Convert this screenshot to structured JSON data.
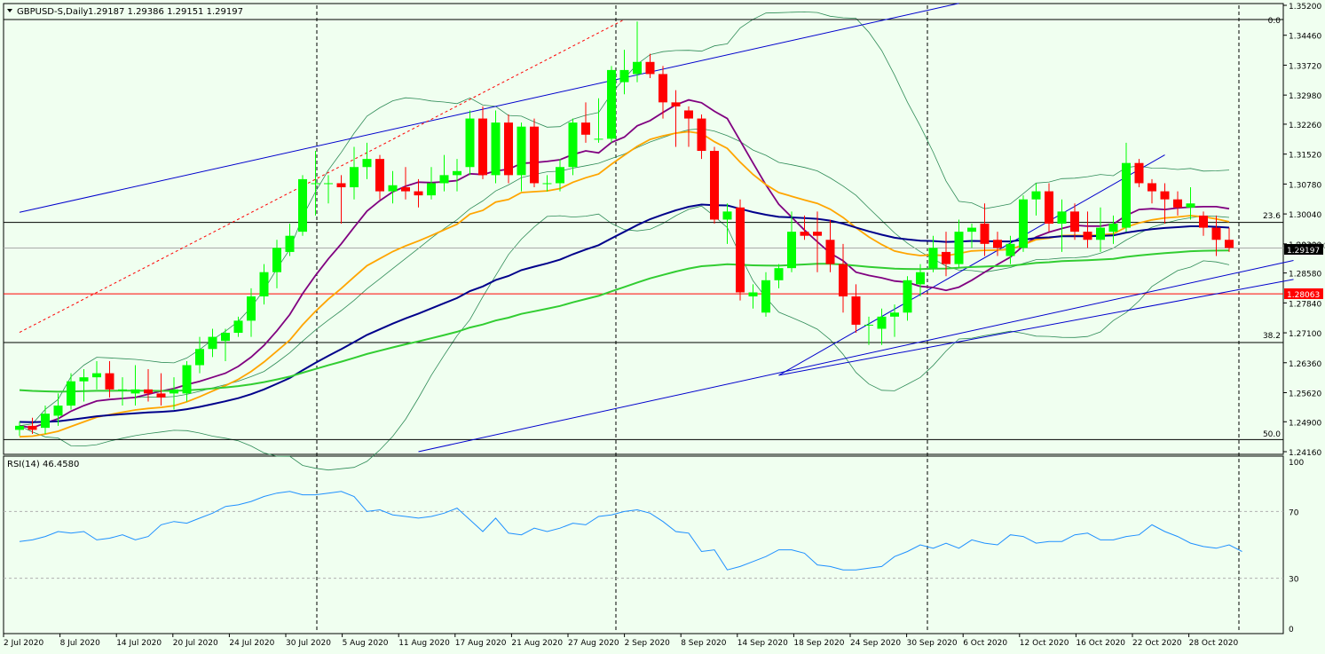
{
  "header": {
    "symbol_label": "GBPUSD-S,Daily",
    "ohlc_label": "1.29187 1.29386 1.29151 1.29197",
    "rsi_label": "RSI(14) 46.4580"
  },
  "colors": {
    "background": "#f0fff0",
    "bull_candle": "#00ff00",
    "bear_candle": "#ff0000",
    "ma_fast": "#800080",
    "ma_mid": "#ffa500",
    "ma_slow": "#00008b",
    "ma_long": "#32cd32",
    "bollinger": "#2e8b57",
    "trendline": "#0000cd",
    "rsi": "#1e90ff"
  },
  "chart_data": {
    "type": "candlestick",
    "x_labels": [
      "2 Jul 2020",
      "8 Jul 2020",
      "14 Jul 2020",
      "20 Jul 2020",
      "24 Jul 2020",
      "30 Jul 2020",
      "5 Aug 2020",
      "11 Aug 2020",
      "17 Aug 2020",
      "21 Aug 2020",
      "27 Aug 2020",
      "2 Sep 2020",
      "8 Sep 2020",
      "14 Sep 2020",
      "18 Sep 2020",
      "24 Sep 2020",
      "30 Sep 2020",
      "6 Oct 2020",
      "12 Oct 2020",
      "16 Oct 2020",
      "22 Oct 2020",
      "28 Oct 2020"
    ],
    "y_ticks": [
      "1.35200",
      "1.34460",
      "1.33720",
      "1.32980",
      "1.32260",
      "1.31520",
      "1.30780",
      "1.30040",
      "1.29300",
      "1.28580",
      "1.27840",
      "1.27100",
      "1.26360",
      "1.25620",
      "1.24900",
      "1.24160"
    ],
    "ylim": [
      1.2416,
      1.352
    ],
    "candles": [
      [
        1.247,
        1.249,
        1.2455,
        1.248
      ],
      [
        1.248,
        1.25,
        1.246,
        1.247
      ],
      [
        1.2475,
        1.253,
        1.246,
        1.251
      ],
      [
        1.2505,
        1.256,
        1.248,
        1.253
      ],
      [
        1.253,
        1.261,
        1.252,
        1.259
      ],
      [
        1.259,
        1.262,
        1.254,
        1.26
      ],
      [
        1.26,
        1.264,
        1.257,
        1.261
      ],
      [
        1.261,
        1.264,
        1.255,
        1.257
      ],
      [
        1.257,
        1.26,
        1.253,
        1.257
      ],
      [
        1.256,
        1.263,
        1.253,
        1.257
      ],
      [
        1.257,
        1.262,
        1.254,
        1.256
      ],
      [
        1.256,
        1.261,
        1.253,
        1.255
      ],
      [
        1.256,
        1.26,
        1.252,
        1.257
      ],
      [
        1.256,
        1.264,
        1.254,
        1.263
      ],
      [
        1.263,
        1.27,
        1.261,
        1.267
      ],
      [
        1.267,
        1.272,
        1.265,
        1.27
      ],
      [
        1.269,
        1.272,
        1.264,
        1.271
      ],
      [
        1.271,
        1.275,
        1.27,
        1.274
      ],
      [
        1.274,
        1.282,
        1.27,
        1.28
      ],
      [
        1.28,
        1.288,
        1.278,
        1.286
      ],
      [
        1.286,
        1.294,
        1.282,
        1.292
      ],
      [
        1.291,
        1.298,
        1.29,
        1.295
      ],
      [
        1.296,
        1.31,
        1.295,
        1.309
      ],
      [
        1.308,
        1.316,
        1.3,
        1.308
      ],
      [
        1.308,
        1.31,
        1.303,
        1.308
      ],
      [
        1.308,
        1.31,
        1.298,
        1.307
      ],
      [
        1.307,
        1.317,
        1.304,
        1.312
      ],
      [
        1.312,
        1.318,
        1.309,
        1.314
      ],
      [
        1.314,
        1.315,
        1.304,
        1.306
      ],
      [
        1.306,
        1.311,
        1.303,
        1.3075
      ],
      [
        1.307,
        1.312,
        1.304,
        1.306
      ],
      [
        1.306,
        1.309,
        1.302,
        1.305
      ],
      [
        1.305,
        1.312,
        1.304,
        1.308
      ],
      [
        1.308,
        1.315,
        1.306,
        1.31
      ],
      [
        1.31,
        1.314,
        1.306,
        1.311
      ],
      [
        1.312,
        1.326,
        1.31,
        1.324
      ],
      [
        1.324,
        1.327,
        1.309,
        1.31
      ],
      [
        1.31,
        1.326,
        1.308,
        1.323
      ],
      [
        1.323,
        1.325,
        1.308,
        1.31
      ],
      [
        1.31,
        1.323,
        1.306,
        1.322
      ],
      [
        1.322,
        1.324,
        1.307,
        1.308
      ],
      [
        1.308,
        1.31,
        1.306,
        1.308
      ],
      [
        1.308,
        1.314,
        1.306,
        1.312
      ],
      [
        1.312,
        1.324,
        1.31,
        1.323
      ],
      [
        1.323,
        1.328,
        1.318,
        1.32
      ],
      [
        1.319,
        1.329,
        1.318,
        1.319
      ],
      [
        1.319,
        1.337,
        1.318,
        1.336
      ],
      [
        1.333,
        1.341,
        1.33,
        1.336
      ],
      [
        1.335,
        1.348,
        1.333,
        1.338
      ],
      [
        1.338,
        1.34,
        1.334,
        1.335
      ],
      [
        1.335,
        1.337,
        1.324,
        1.328
      ],
      [
        1.328,
        1.331,
        1.317,
        1.327
      ],
      [
        1.326,
        1.327,
        1.317,
        1.324
      ],
      [
        1.324,
        1.325,
        1.314,
        1.316
      ],
      [
        1.316,
        1.317,
        1.298,
        1.299
      ],
      [
        1.299,
        1.303,
        1.293,
        1.301
      ],
      [
        1.302,
        1.304,
        1.279,
        1.281
      ],
      [
        1.28,
        1.283,
        1.277,
        1.281
      ],
      [
        1.276,
        1.286,
        1.275,
        1.284
      ],
      [
        1.284,
        1.288,
        1.282,
        1.287
      ],
      [
        1.287,
        1.301,
        1.286,
        1.296
      ],
      [
        1.296,
        1.3,
        1.294,
        1.295
      ],
      [
        1.296,
        1.301,
        1.286,
        1.295
      ],
      [
        1.294,
        1.299,
        1.286,
        1.288
      ],
      [
        1.288,
        1.293,
        1.276,
        1.28
      ],
      [
        1.28,
        1.283,
        1.271,
        1.273
      ],
      [
        1.273,
        1.275,
        1.268,
        1.273
      ],
      [
        1.272,
        1.277,
        1.268,
        1.275
      ],
      [
        1.275,
        1.278,
        1.27,
        1.276
      ],
      [
        1.276,
        1.285,
        1.274,
        1.284
      ],
      [
        1.283,
        1.288,
        1.28,
        1.286
      ],
      [
        1.287,
        1.295,
        1.286,
        1.292
      ],
      [
        1.291,
        1.296,
        1.285,
        1.288
      ],
      [
        1.288,
        1.299,
        1.287,
        1.296
      ],
      [
        1.296,
        1.298,
        1.292,
        1.297
      ],
      [
        1.298,
        1.303,
        1.29,
        1.293
      ],
      [
        1.294,
        1.296,
        1.29,
        1.292
      ],
      [
        1.29,
        1.295,
        1.288,
        1.293
      ],
      [
        1.292,
        1.305,
        1.291,
        1.304
      ],
      [
        1.304,
        1.308,
        1.3,
        1.306
      ],
      [
        1.306,
        1.308,
        1.296,
        1.298
      ],
      [
        1.298,
        1.304,
        1.291,
        1.301
      ],
      [
        1.301,
        1.303,
        1.294,
        1.296
      ],
      [
        1.296,
        1.301,
        1.292,
        1.294
      ],
      [
        1.294,
        1.302,
        1.291,
        1.297
      ],
      [
        1.296,
        1.3,
        1.293,
        1.298
      ],
      [
        1.297,
        1.318,
        1.296,
        1.313
      ],
      [
        1.313,
        1.314,
        1.307,
        1.308
      ],
      [
        1.308,
        1.309,
        1.303,
        1.306
      ],
      [
        1.306,
        1.308,
        1.298,
        1.304
      ],
      [
        1.304,
        1.306,
        1.3,
        1.302
      ],
      [
        1.302,
        1.307,
        1.299,
        1.303
      ],
      [
        1.3,
        1.301,
        1.295,
        1.297
      ],
      [
        1.297,
        1.3,
        1.29,
        1.294
      ],
      [
        1.294,
        1.297,
        1.291,
        1.292
      ]
    ],
    "rsi": {
      "label": "RSI(14) 46.4580",
      "ylim": [
        0,
        100
      ],
      "ticks": [
        100,
        70,
        30,
        0
      ],
      "levels": [
        70,
        30
      ],
      "values": [
        52,
        53,
        55,
        58,
        57,
        58,
        53,
        54,
        56,
        53,
        55,
        62,
        64,
        63,
        66,
        69,
        73,
        74,
        76,
        79,
        81,
        82,
        80,
        80,
        81,
        82,
        79,
        70,
        71,
        68,
        67,
        66,
        67,
        69,
        72,
        65,
        58,
        66,
        57,
        56,
        60,
        58,
        60,
        63,
        62,
        67,
        68,
        70,
        71,
        69,
        64,
        58,
        57,
        46,
        47,
        35,
        37,
        40,
        43,
        47,
        47,
        45,
        38,
        37,
        35,
        35,
        36,
        37,
        43,
        46,
        50,
        48,
        51,
        48,
        53,
        51,
        50,
        56,
        55,
        51,
        52,
        52,
        56,
        57,
        53,
        53,
        55,
        56,
        62,
        58,
        55,
        51,
        49,
        48,
        50,
        46
      ]
    },
    "annotations": {
      "fib_labels": [
        "0.0",
        "23.6",
        "38.2",
        "50.0"
      ],
      "price_tags": [
        "1.29197",
        "1.28063"
      ],
      "partial_label": "1.29300"
    },
    "legend": "none",
    "grid": false
  }
}
